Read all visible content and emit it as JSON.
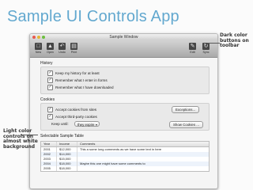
{
  "slide_title": "Sample UI Controls App",
  "window": {
    "title": "Sample Window",
    "toolbar": {
      "left_buttons": [
        {
          "label": "New",
          "icon": "new-file-icon"
        },
        {
          "label": "Open",
          "icon": "folder-icon"
        },
        {
          "label": "Undo",
          "icon": "undo-icon"
        },
        {
          "label": "Print",
          "icon": "print-icon"
        }
      ],
      "right_buttons": [
        {
          "label": "Edit",
          "icon": "pencil-icon"
        },
        {
          "label": "Sync",
          "icon": "sync-icon"
        }
      ]
    },
    "history": {
      "heading": "History",
      "options": [
        {
          "label": "Keep my history for at least",
          "checked": true
        },
        {
          "label": "Remember what I enter in forms",
          "checked": true
        },
        {
          "label": "Remember what I have downloaded",
          "checked": true
        }
      ]
    },
    "cookies": {
      "heading": "Cookies",
      "options": [
        {
          "label": "Accept cookies from sites",
          "checked": true
        },
        {
          "label": "Accept third-party cookies",
          "checked": true
        }
      ],
      "exceptions_button": "Exceptions...",
      "keep_until_label": "Keep until:",
      "keep_until_value": "they expire",
      "show_cookies_button": "Show Cookies ..."
    },
    "table": {
      "heading": "Selectable Sample Table",
      "columns": [
        "Year",
        "Income",
        "Comments"
      ],
      "rows": [
        [
          "2001",
          "$12,000",
          "This a some long comments as we have some text in here"
        ],
        [
          "2002",
          "$14,000",
          ""
        ],
        [
          "2003",
          "$15,000",
          ""
        ],
        [
          "2004",
          "$18,000",
          "Maybe this one might have some comments to"
        ],
        [
          "2005",
          "$18,000",
          ""
        ]
      ]
    }
  },
  "notes": {
    "right": "Dark color\nbuttons on\ntoolbar",
    "left": "Light color\ncontrols on\nalmost white\nbackground"
  }
}
